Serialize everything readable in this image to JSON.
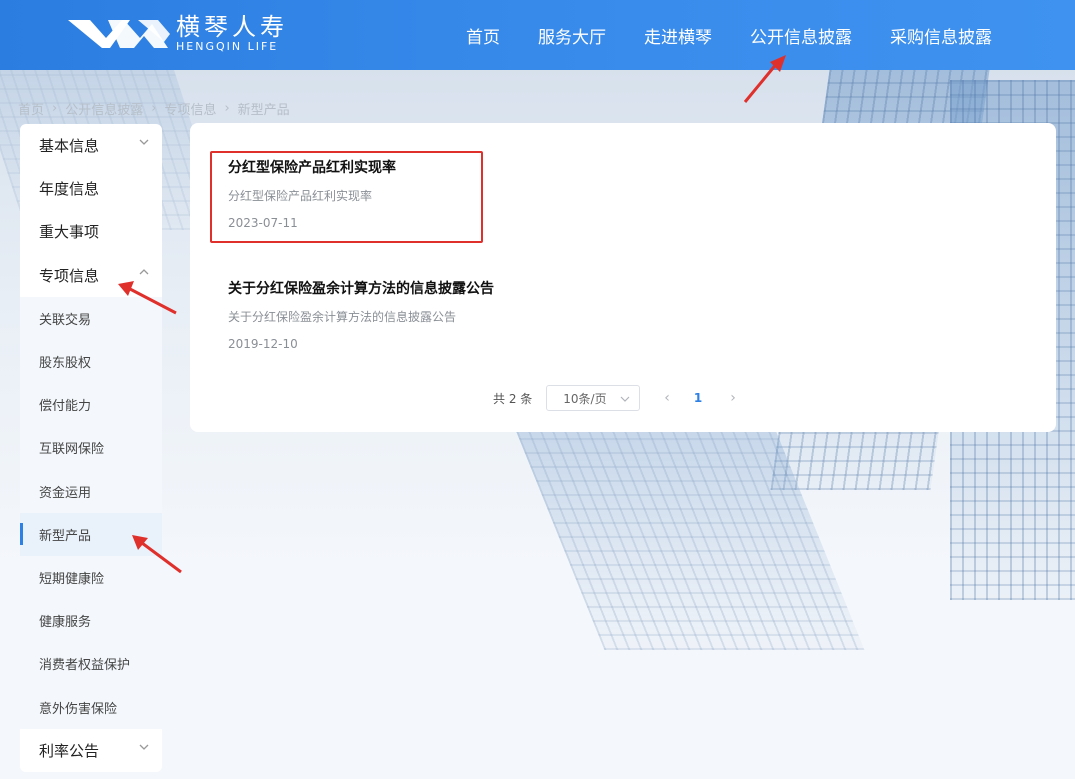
{
  "header": {
    "logo_cn": "横琴人寿",
    "logo_en": "HENGQIN LIFE",
    "nav": [
      {
        "label": "首页"
      },
      {
        "label": "服务大厅"
      },
      {
        "label": "走进横琴"
      },
      {
        "label": "公开信息披露"
      },
      {
        "label": "采购信息披露"
      }
    ]
  },
  "breadcrumb": [
    "首页",
    "公开信息披露",
    "专项信息",
    "新型产品"
  ],
  "sidebar": {
    "items": [
      {
        "label": "基本信息",
        "type": "top",
        "chevron": "down"
      },
      {
        "label": "年度信息",
        "type": "top"
      },
      {
        "label": "重大事项",
        "type": "top"
      },
      {
        "label": "专项信息",
        "type": "top",
        "chevron": "up"
      },
      {
        "label": "关联交易",
        "type": "sub"
      },
      {
        "label": "股东股权",
        "type": "sub"
      },
      {
        "label": "偿付能力",
        "type": "sub"
      },
      {
        "label": "互联网保险",
        "type": "sub"
      },
      {
        "label": "资金运用",
        "type": "sub"
      },
      {
        "label": "新型产品",
        "type": "sub",
        "active": true
      },
      {
        "label": "短期健康险",
        "type": "sub"
      },
      {
        "label": "健康服务",
        "type": "sub"
      },
      {
        "label": "消费者权益保护",
        "type": "sub"
      },
      {
        "label": "意外伤害保险",
        "type": "sub"
      },
      {
        "label": "利率公告",
        "type": "top",
        "chevron": "down"
      }
    ]
  },
  "articles": [
    {
      "title": "分红型保险产品红利实现率",
      "desc": "分红型保险产品红利实现率",
      "date": "2023-07-11"
    },
    {
      "title": "关于分红保险盈余计算方法的信息披露公告",
      "desc": "关于分红保险盈余计算方法的信息披露公告",
      "date": "2019-12-10"
    }
  ],
  "pagination": {
    "total_text": "共 2 条",
    "page_size": "10条/页",
    "prev": "‹",
    "current": "1",
    "next": "›"
  },
  "colors": {
    "header_blue": "#2b7de0",
    "accent": "#2d80e4",
    "annotation_red": "#e0302c"
  }
}
